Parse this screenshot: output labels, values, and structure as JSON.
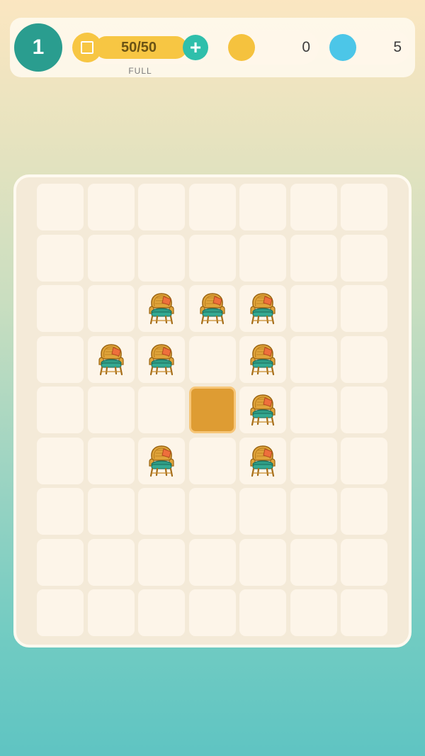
{
  "hud": {
    "level": "1",
    "energy": {
      "value": "50/50",
      "status": "FULL",
      "add_label": "+"
    },
    "coins": {
      "value": "0",
      "color": "#f5c23e"
    },
    "gems": {
      "value": "5",
      "color": "#4cc6e8"
    }
  },
  "board": {
    "rows": 9,
    "cols": 7,
    "items": [
      {
        "row": 2,
        "col": 2,
        "type": "wicker-chair"
      },
      {
        "row": 2,
        "col": 3,
        "type": "wicker-chair"
      },
      {
        "row": 2,
        "col": 4,
        "type": "wicker-chair"
      },
      {
        "row": 3,
        "col": 1,
        "type": "wicker-chair"
      },
      {
        "row": 3,
        "col": 2,
        "type": "wicker-chair"
      },
      {
        "row": 3,
        "col": 4,
        "type": "wicker-chair"
      },
      {
        "row": 4,
        "col": 4,
        "type": "wicker-chair"
      },
      {
        "row": 5,
        "col": 2,
        "type": "wicker-chair"
      },
      {
        "row": 5,
        "col": 4,
        "type": "wicker-chair"
      }
    ],
    "selected": {
      "row": 4,
      "col": 3
    }
  }
}
